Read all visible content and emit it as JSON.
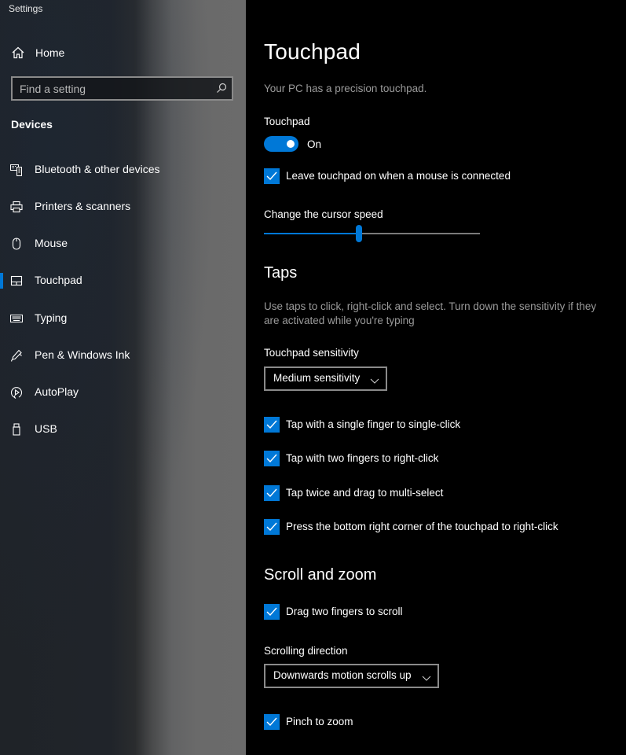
{
  "window": {
    "title": "Settings"
  },
  "sidebar": {
    "home_label": "Home",
    "search": {
      "placeholder": "Find a setting",
      "value": ""
    },
    "section_title": "Devices",
    "selected_index": 3,
    "items": [
      {
        "label": "Bluetooth & other devices",
        "icon": "bluetooth-devices-icon"
      },
      {
        "label": "Printers & scanners",
        "icon": "printer-icon"
      },
      {
        "label": "Mouse",
        "icon": "mouse-icon"
      },
      {
        "label": "Touchpad",
        "icon": "touchpad-icon"
      },
      {
        "label": "Typing",
        "icon": "keyboard-icon"
      },
      {
        "label": "Pen & Windows Ink",
        "icon": "pen-icon"
      },
      {
        "label": "AutoPlay",
        "icon": "autoplay-icon"
      },
      {
        "label": "USB",
        "icon": "usb-icon"
      }
    ]
  },
  "main": {
    "title": "Touchpad",
    "subtitle": "Your PC has a precision touchpad.",
    "touchpad_toggle": {
      "label": "Touchpad",
      "state_label": "On",
      "on": true
    },
    "leave_on_checkbox": {
      "label": "Leave touchpad on when a mouse is connected",
      "checked": true
    },
    "cursor_speed": {
      "label": "Change the cursor speed",
      "fraction": 0.44
    },
    "taps": {
      "heading": "Taps",
      "description_line1": "Use taps to click, right-click and select. Turn down the sensitivity if they",
      "description_line2": "are activated while you're typing",
      "sensitivity_label": "Touchpad sensitivity",
      "sensitivity_value": "Medium sensitivity",
      "options": [
        {
          "label": "Tap with a single finger to single-click",
          "checked": true
        },
        {
          "label": "Tap with two fingers to right-click",
          "checked": true
        },
        {
          "label": "Tap twice and drag to multi-select",
          "checked": true
        },
        {
          "label": "Press the bottom right corner of the touchpad to right-click",
          "checked": true
        }
      ]
    },
    "scroll_zoom": {
      "heading": "Scroll and zoom",
      "drag_scroll": {
        "label": "Drag two fingers to scroll",
        "checked": true
      },
      "direction_label": "Scrolling direction",
      "direction_value": "Downwards motion scrolls up",
      "pinch_zoom": {
        "label": "Pinch to zoom",
        "checked": true
      }
    }
  },
  "colors": {
    "accent": "#0078d7",
    "background": "#000000",
    "secondary_text": "#9a9a9a"
  }
}
